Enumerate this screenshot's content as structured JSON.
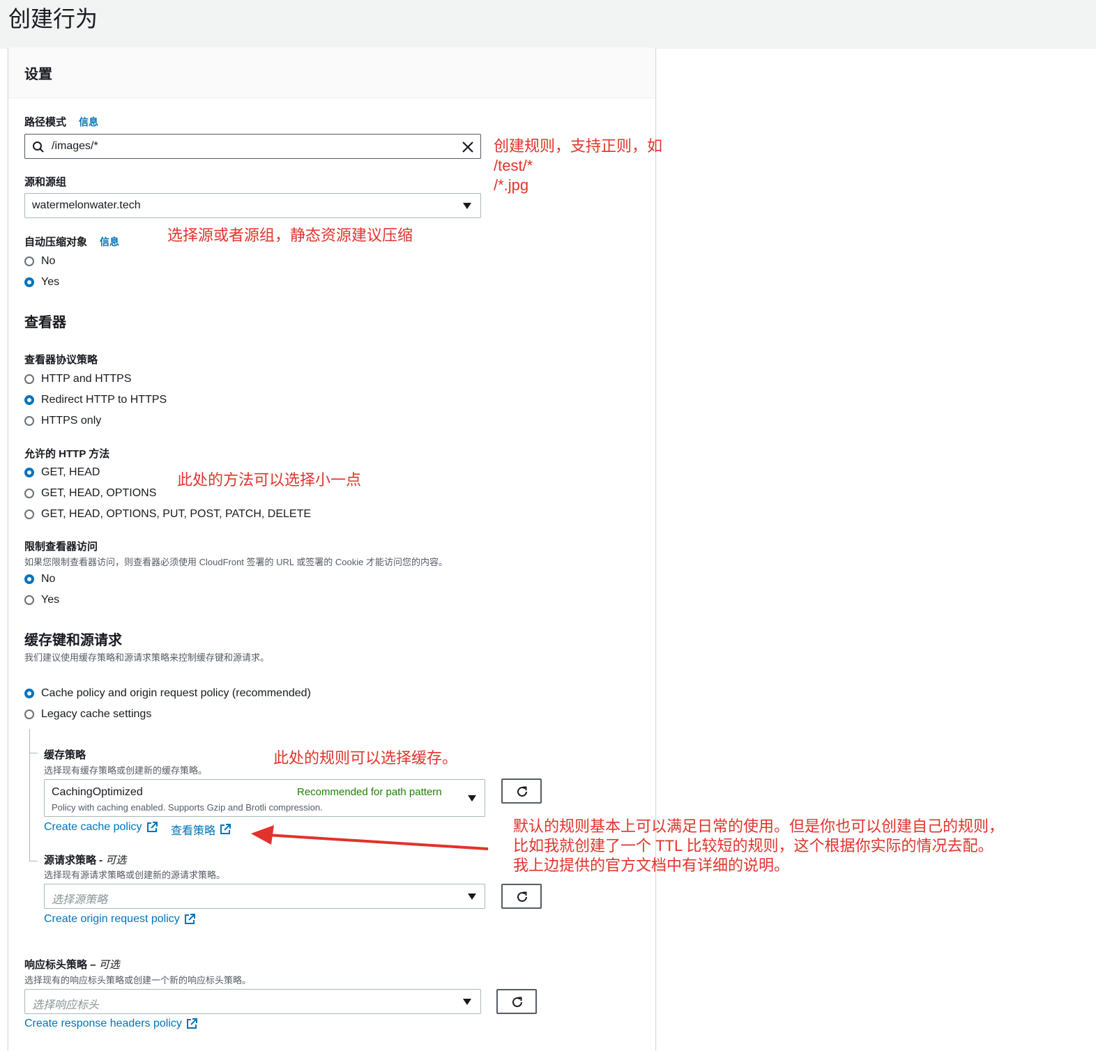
{
  "page": {
    "title": "创建行为"
  },
  "settings": {
    "heading": "设置",
    "path_pattern": {
      "label": "路径模式",
      "info": "信息",
      "value": "/images/*"
    },
    "origin": {
      "label": "源和源组",
      "value": "watermelonwater.tech"
    },
    "compress": {
      "label": "自动压缩对象",
      "info": "信息",
      "options": [
        {
          "label": "No",
          "selected": false
        },
        {
          "label": "Yes",
          "selected": true
        }
      ]
    }
  },
  "viewer": {
    "heading": "查看器",
    "protocol": {
      "label": "查看器协议策略",
      "options": [
        {
          "label": "HTTP and HTTPS",
          "selected": false
        },
        {
          "label": "Redirect HTTP to HTTPS",
          "selected": true
        },
        {
          "label": "HTTPS only",
          "selected": false
        }
      ]
    },
    "methods": {
      "label": "允许的 HTTP 方法",
      "options": [
        {
          "label": "GET, HEAD",
          "selected": true
        },
        {
          "label": "GET, HEAD, OPTIONS",
          "selected": false
        },
        {
          "label": "GET, HEAD, OPTIONS, PUT, POST, PATCH, DELETE",
          "selected": false
        }
      ]
    },
    "restrict": {
      "label": "限制查看器访问",
      "desc": "如果您限制查看器访问，则查看器必须使用 CloudFront 签署的 URL 或签署的 Cookie 才能访问您的内容。",
      "options": [
        {
          "label": "No",
          "selected": true
        },
        {
          "label": "Yes",
          "selected": false
        }
      ]
    }
  },
  "cache": {
    "heading": "缓存键和源请求",
    "desc": "我们建议使用缓存策略和源请求策略来控制缓存键和源请求。",
    "mode_options": [
      {
        "label": "Cache policy and origin request policy (recommended)",
        "selected": true
      },
      {
        "label": "Legacy cache settings",
        "selected": false
      }
    ],
    "cache_policy": {
      "label": "缓存策略",
      "desc": "选择现有缓存策略或创建新的缓存策略。",
      "value": "CachingOptimized",
      "recommended": "Recommended for path pattern",
      "value_desc": "Policy with caching enabled. Supports Gzip and Brotli compression.",
      "create_link": "Create cache policy",
      "view_link": "查看策略"
    },
    "origin_request_policy": {
      "label": "源请求策略",
      "optional": "可选",
      "desc": "选择现有源请求策略或创建新的源请求策略。",
      "placeholder": "选择源策略",
      "create_link": "Create origin request policy"
    }
  },
  "response_headers": {
    "label": "响应标头策略",
    "optional": "可选",
    "desc": "选择现有的响应标头策略或创建一个新的响应标头策略。",
    "placeholder": "选择响应标头",
    "create_link": "Create response headers policy"
  },
  "annotations": {
    "path_note": [
      "创建规则，支持正则，如",
      "/test/*",
      "/*.jpg"
    ],
    "origin_note": "选择源或者源组，静态资源建议压缩",
    "methods_note": "此处的方法可以选择小一点",
    "cache_note": "此处的规则可以选择缓存。",
    "default_note": [
      "默认的规则基本上可以满足日常的使用。但是你也可以创建自己的规则，",
      "比如我就创建了一个 TTL 比较短的规则，这个根据你实际的情况去配。",
      "我上边提供的官方文档中有详细的说明。"
    ],
    "colors": {
      "annotation": "#e0332b",
      "link": "#0073bb",
      "recommended": "#1d8102"
    }
  }
}
